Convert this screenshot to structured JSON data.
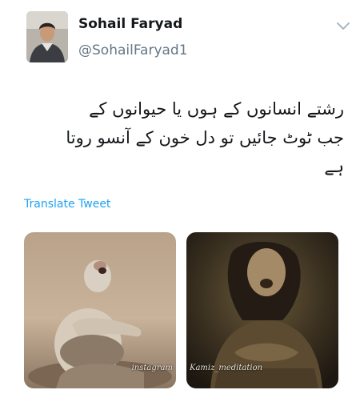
{
  "tweet": {
    "author_name": "Sohail Faryad",
    "author_handle": "@SohailFaryad1",
    "text_lines": [
      "رشتے انسانوں کے ہوں یا  حیوانوں کے",
      "جب  ٹوٹ  جائیں تو دل خون کے آنسو  روتا",
      "ہے"
    ],
    "translate_label": "Translate Tweet"
  },
  "media": {
    "left_watermark": "instagram",
    "right_watermark": "Kamiz_meditation"
  },
  "colors": {
    "link_blue": "#1da1f2",
    "muted_gray": "#657786",
    "text_dark": "#14171a"
  },
  "icons": [
    "chevron-down-icon"
  ]
}
